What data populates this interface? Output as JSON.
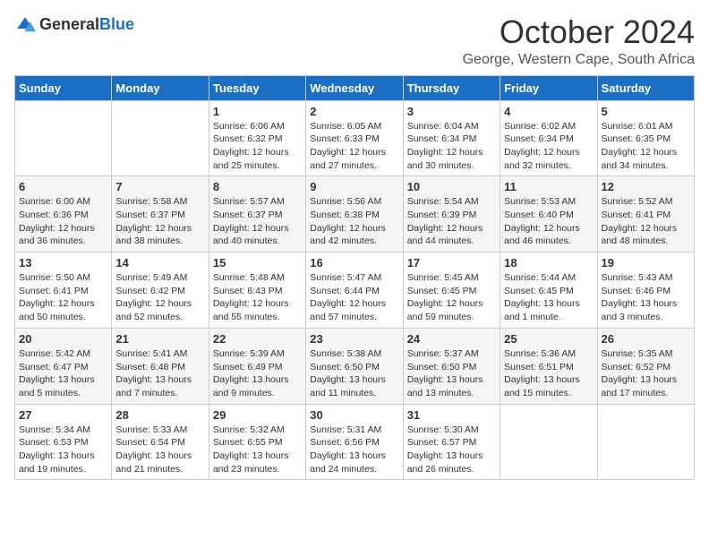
{
  "logo": {
    "general": "General",
    "blue": "Blue"
  },
  "title": "October 2024",
  "location": "George, Western Cape, South Africa",
  "days_of_week": [
    "Sunday",
    "Monday",
    "Tuesday",
    "Wednesday",
    "Thursday",
    "Friday",
    "Saturday"
  ],
  "weeks": [
    [
      {
        "day": "",
        "info": ""
      },
      {
        "day": "",
        "info": ""
      },
      {
        "day": "1",
        "info": "Sunrise: 6:06 AM\nSunset: 6:32 PM\nDaylight: 12 hours and 25 minutes."
      },
      {
        "day": "2",
        "info": "Sunrise: 6:05 AM\nSunset: 6:33 PM\nDaylight: 12 hours and 27 minutes."
      },
      {
        "day": "3",
        "info": "Sunrise: 6:04 AM\nSunset: 6:34 PM\nDaylight: 12 hours and 30 minutes."
      },
      {
        "day": "4",
        "info": "Sunrise: 6:02 AM\nSunset: 6:34 PM\nDaylight: 12 hours and 32 minutes."
      },
      {
        "day": "5",
        "info": "Sunrise: 6:01 AM\nSunset: 6:35 PM\nDaylight: 12 hours and 34 minutes."
      }
    ],
    [
      {
        "day": "6",
        "info": "Sunrise: 6:00 AM\nSunset: 6:36 PM\nDaylight: 12 hours and 36 minutes."
      },
      {
        "day": "7",
        "info": "Sunrise: 5:58 AM\nSunset: 6:37 PM\nDaylight: 12 hours and 38 minutes."
      },
      {
        "day": "8",
        "info": "Sunrise: 5:57 AM\nSunset: 6:37 PM\nDaylight: 12 hours and 40 minutes."
      },
      {
        "day": "9",
        "info": "Sunrise: 5:56 AM\nSunset: 6:38 PM\nDaylight: 12 hours and 42 minutes."
      },
      {
        "day": "10",
        "info": "Sunrise: 5:54 AM\nSunset: 6:39 PM\nDaylight: 12 hours and 44 minutes."
      },
      {
        "day": "11",
        "info": "Sunrise: 5:53 AM\nSunset: 6:40 PM\nDaylight: 12 hours and 46 minutes."
      },
      {
        "day": "12",
        "info": "Sunrise: 5:52 AM\nSunset: 6:41 PM\nDaylight: 12 hours and 48 minutes."
      }
    ],
    [
      {
        "day": "13",
        "info": "Sunrise: 5:50 AM\nSunset: 6:41 PM\nDaylight: 12 hours and 50 minutes."
      },
      {
        "day": "14",
        "info": "Sunrise: 5:49 AM\nSunset: 6:42 PM\nDaylight: 12 hours and 52 minutes."
      },
      {
        "day": "15",
        "info": "Sunrise: 5:48 AM\nSunset: 6:43 PM\nDaylight: 12 hours and 55 minutes."
      },
      {
        "day": "16",
        "info": "Sunrise: 5:47 AM\nSunset: 6:44 PM\nDaylight: 12 hours and 57 minutes."
      },
      {
        "day": "17",
        "info": "Sunrise: 5:45 AM\nSunset: 6:45 PM\nDaylight: 12 hours and 59 minutes."
      },
      {
        "day": "18",
        "info": "Sunrise: 5:44 AM\nSunset: 6:45 PM\nDaylight: 13 hours and 1 minute."
      },
      {
        "day": "19",
        "info": "Sunrise: 5:43 AM\nSunset: 6:46 PM\nDaylight: 13 hours and 3 minutes."
      }
    ],
    [
      {
        "day": "20",
        "info": "Sunrise: 5:42 AM\nSunset: 6:47 PM\nDaylight: 13 hours and 5 minutes."
      },
      {
        "day": "21",
        "info": "Sunrise: 5:41 AM\nSunset: 6:48 PM\nDaylight: 13 hours and 7 minutes."
      },
      {
        "day": "22",
        "info": "Sunrise: 5:39 AM\nSunset: 6:49 PM\nDaylight: 13 hours and 9 minutes."
      },
      {
        "day": "23",
        "info": "Sunrise: 5:38 AM\nSunset: 6:50 PM\nDaylight: 13 hours and 11 minutes."
      },
      {
        "day": "24",
        "info": "Sunrise: 5:37 AM\nSunset: 6:50 PM\nDaylight: 13 hours and 13 minutes."
      },
      {
        "day": "25",
        "info": "Sunrise: 5:36 AM\nSunset: 6:51 PM\nDaylight: 13 hours and 15 minutes."
      },
      {
        "day": "26",
        "info": "Sunrise: 5:35 AM\nSunset: 6:52 PM\nDaylight: 13 hours and 17 minutes."
      }
    ],
    [
      {
        "day": "27",
        "info": "Sunrise: 5:34 AM\nSunset: 6:53 PM\nDaylight: 13 hours and 19 minutes."
      },
      {
        "day": "28",
        "info": "Sunrise: 5:33 AM\nSunset: 6:54 PM\nDaylight: 13 hours and 21 minutes."
      },
      {
        "day": "29",
        "info": "Sunrise: 5:32 AM\nSunset: 6:55 PM\nDaylight: 13 hours and 23 minutes."
      },
      {
        "day": "30",
        "info": "Sunrise: 5:31 AM\nSunset: 6:56 PM\nDaylight: 13 hours and 24 minutes."
      },
      {
        "day": "31",
        "info": "Sunrise: 5:30 AM\nSunset: 6:57 PM\nDaylight: 13 hours and 26 minutes."
      },
      {
        "day": "",
        "info": ""
      },
      {
        "day": "",
        "info": ""
      }
    ]
  ]
}
